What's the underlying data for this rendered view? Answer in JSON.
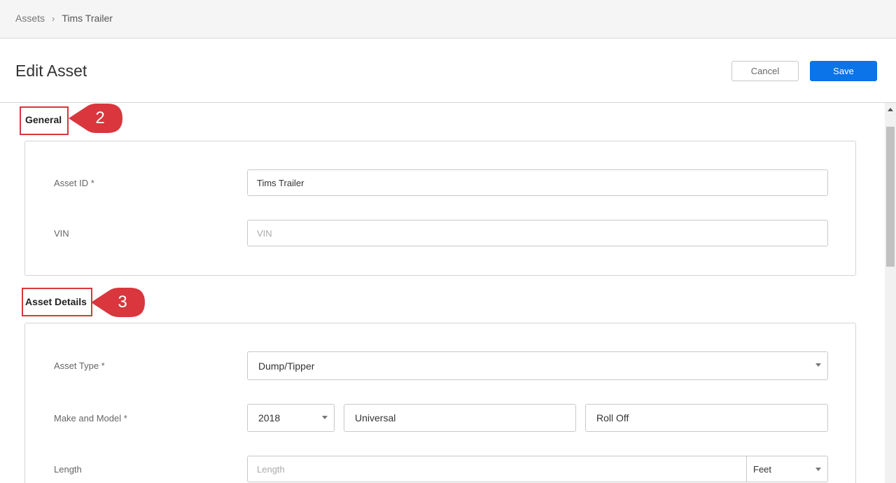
{
  "breadcrumb": {
    "root": "Assets",
    "separator": "›",
    "current": "Tims Trailer"
  },
  "header": {
    "title": "Edit Asset",
    "cancel_label": "Cancel",
    "save_label": "Save"
  },
  "sections": {
    "general": {
      "title": "General",
      "callout": "2",
      "asset_id_label": "Asset ID *",
      "asset_id_value": "Tims Trailer",
      "vin_label": "VIN",
      "vin_placeholder": "VIN"
    },
    "asset_details": {
      "title": "Asset Details",
      "callout": "3",
      "asset_type_label": "Asset Type *",
      "asset_type_value": "Dump/Tipper",
      "make_model_label": "Make and Model *",
      "year_value": "2018",
      "make_value": "Universal",
      "model_value": "Roll Off",
      "length_label": "Length",
      "length_placeholder": "Length",
      "length_unit": "Feet"
    }
  },
  "colors": {
    "accent": "#0a74e8",
    "callout": "#d9363e"
  }
}
